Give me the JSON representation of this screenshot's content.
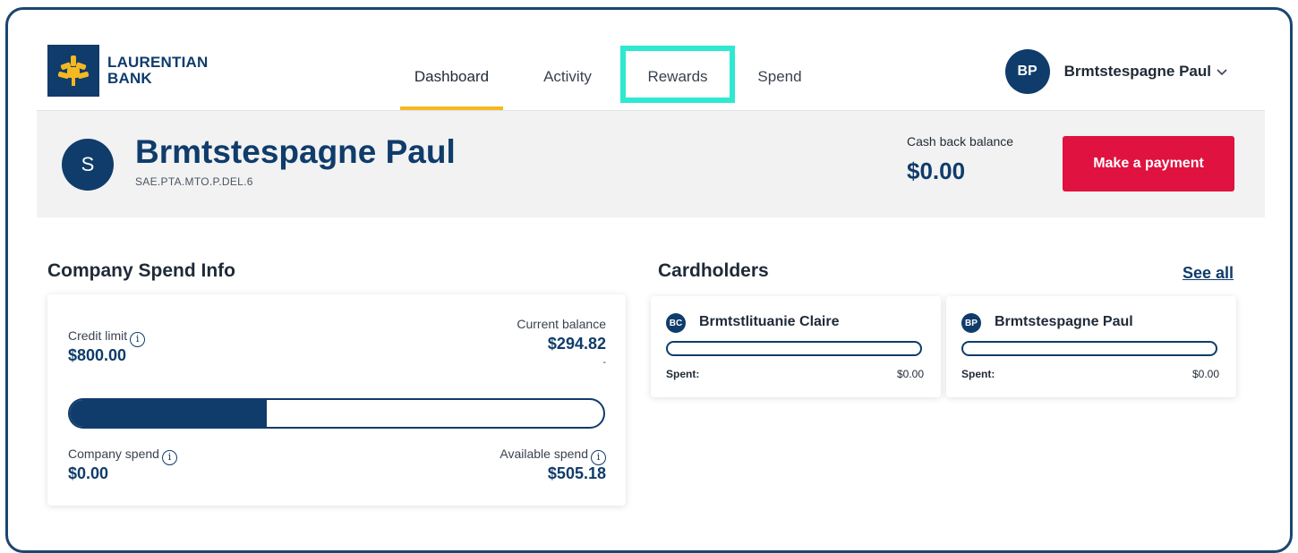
{
  "brand": {
    "line1": "LAURENTIAN",
    "line2": "BANK",
    "color": "#0f3c6b",
    "accent": "#f5b820"
  },
  "nav": {
    "items": [
      {
        "label": "Dashboard",
        "active": true
      },
      {
        "label": "Activity",
        "active": false
      },
      {
        "label": "Rewards",
        "active": false,
        "highlighted": true
      },
      {
        "label": "Spend",
        "active": false
      }
    ]
  },
  "user": {
    "initials": "BP",
    "name": "Brmtstespagne Paul"
  },
  "banner": {
    "initial": "S",
    "name": "Brmtstespagne Paul",
    "subtitle": "SAE.PTA.MTO.P.DEL.6",
    "cashback_label": "Cash back balance",
    "cashback_value": "$0.00",
    "pay_button": "Make a payment",
    "pay_button_color": "#e0123f"
  },
  "company_spend": {
    "title": "Company Spend Info",
    "credit_limit_label": "Credit limit",
    "credit_limit_value": "$800.00",
    "current_balance_label": "Current balance",
    "current_balance_value": "$294.82",
    "current_balance_note": "-",
    "balance_fraction": 0.3685,
    "company_spend_label": "Company spend",
    "company_spend_value": "$0.00",
    "available_spend_label": "Available spend",
    "available_spend_value": "$505.18"
  },
  "cardholders": {
    "title": "Cardholders",
    "see_all": "See all",
    "items": [
      {
        "initials": "BC",
        "name": "Brmtstlituanie Claire",
        "spent_label": "Spent:",
        "spent_value": "$0.00",
        "spent_fraction": 0
      },
      {
        "initials": "BP",
        "name": "Brmtstespagne Paul",
        "spent_label": "Spent:",
        "spent_value": "$0.00",
        "spent_fraction": 0
      }
    ]
  },
  "icons": {
    "logo": "laurentian-leaf-logo",
    "info": "info-icon",
    "chevron": "chevron-down-icon"
  }
}
